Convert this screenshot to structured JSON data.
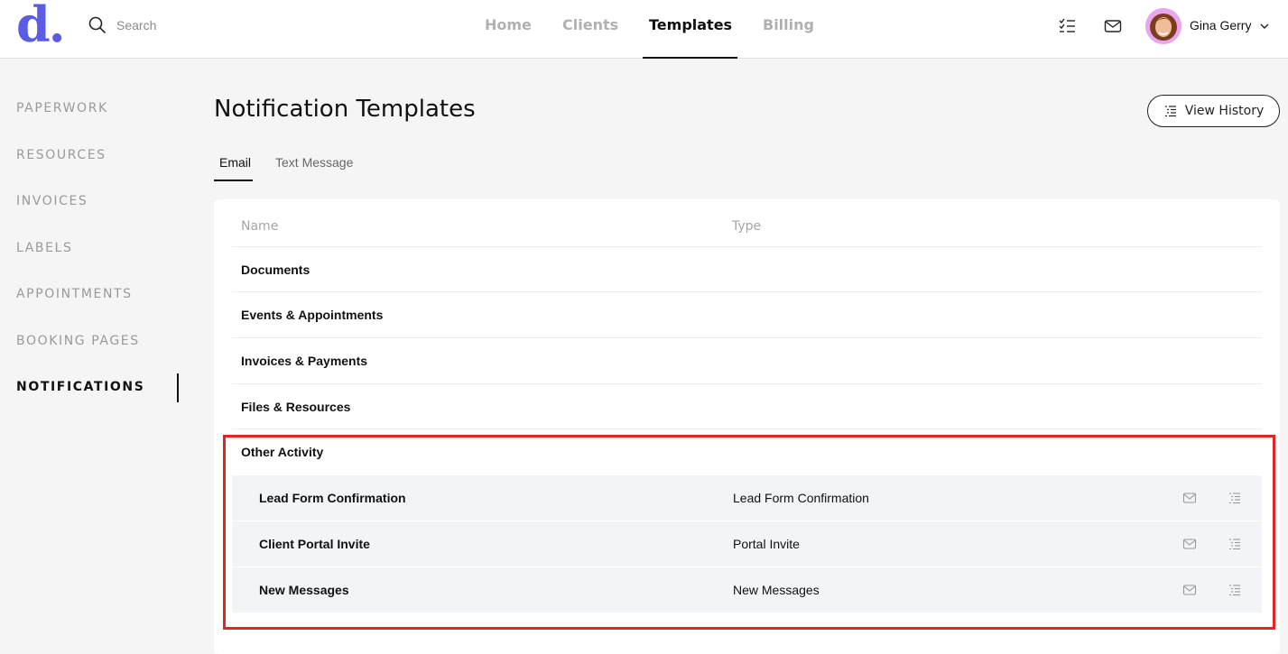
{
  "logo": "d.",
  "search": {
    "placeholder": "Search"
  },
  "nav": {
    "home": "Home",
    "clients": "Clients",
    "templates": "Templates",
    "billing": "Billing"
  },
  "header_icons": [
    "checklist-icon",
    "mail-icon"
  ],
  "user": {
    "name": "Gina Gerry"
  },
  "sidebar": {
    "items": [
      {
        "label": "PAPERWORK"
      },
      {
        "label": "RESOURCES"
      },
      {
        "label": "INVOICES"
      },
      {
        "label": "LABELS"
      },
      {
        "label": "APPOINTMENTS"
      },
      {
        "label": "BOOKING PAGES"
      },
      {
        "label": "NOTIFICATIONS",
        "active": true
      }
    ]
  },
  "page": {
    "title": "Notification Templates",
    "view_history": "View History"
  },
  "tabs": {
    "email": "Email",
    "text": "Text Message"
  },
  "table": {
    "headers": {
      "name": "Name",
      "type": "Type"
    },
    "groups": [
      "Documents",
      "Events & Appointments",
      "Invoices & Payments",
      "Files & Resources",
      "Other Activity"
    ],
    "rows": [
      {
        "name": "Lead Form Confirmation",
        "type": "Lead Form Confirmation"
      },
      {
        "name": "Client Portal Invite",
        "type": "Portal Invite"
      },
      {
        "name": "New Messages",
        "type": "New Messages"
      }
    ]
  },
  "colors": {
    "brand": "#5b5ce6",
    "highlight": "#e0262b",
    "row_bg": "#f3f4f8"
  }
}
